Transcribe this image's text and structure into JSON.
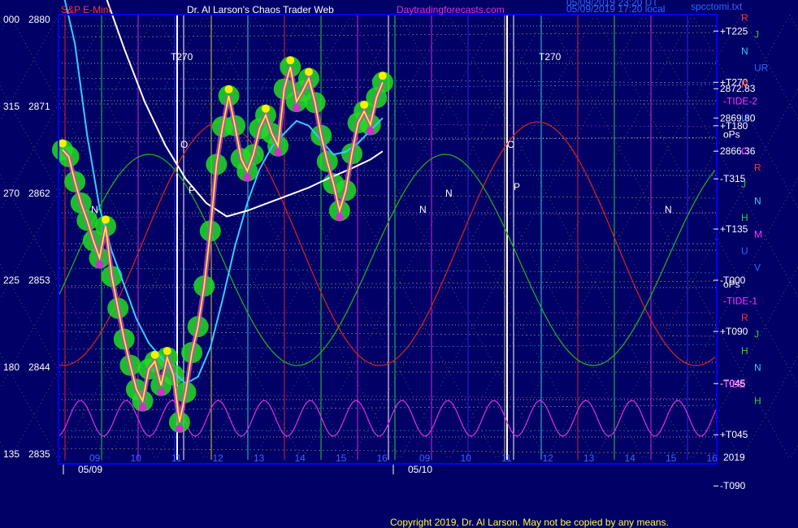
{
  "header": {
    "symbol": "S&P E-Mini",
    "title": "Dr. Al Larson's Chaos Trader Web",
    "site": "Daytradingforecasts.com",
    "stamp_line1": "05/09/2019 23:20 UT",
    "stamp_line2": "05/09/2019 17:20 local",
    "filename": "spcctomi.txt"
  },
  "footer": {
    "copyright": "Copyright 2019, Dr. Al Larson. May not be copied by any means.",
    "year_label": "2019"
  },
  "colors": {
    "background": "#000066",
    "border": "#0000ff",
    "price": "#ffff00",
    "mid_ma": "#33ccff",
    "slow_ma": "#ffffff",
    "glow": "#22dd22",
    "swing_high_marker": "#ffee00",
    "swing_low_marker": "#cc33cc",
    "red_path": "#cc2222",
    "green_path": "#22aa22",
    "tide_magenta": "#dd33dd"
  },
  "chart_data": {
    "type": "line",
    "title": "S&P E-Mini",
    "ylim": [
      2835,
      2880
    ],
    "left_axis": {
      "price_labels": [
        "2880",
        "2871",
        "2862",
        "2853",
        "2844",
        "2835"
      ],
      "degree_labels": [
        "000",
        "315",
        "270",
        "225",
        "180",
        "135"
      ]
    },
    "x_hour_labels": [
      "09",
      "10",
      "11",
      "12",
      "13",
      "14",
      "15",
      "16",
      "09",
      "10",
      "11",
      "12",
      "13",
      "14",
      "15",
      "16"
    ],
    "date_labels": [
      "05/09",
      "05/10"
    ],
    "right_axis_labels": [
      {
        "text": "+T225",
        "price": 2878.8
      },
      {
        "text": "+T270",
        "price": 2873.5
      },
      {
        "text": "2872.83",
        "price": 2872.83
      },
      {
        "text": "2869.80",
        "price": 2869.8
      },
      {
        "text": "+T180",
        "price": 2869.0
      },
      {
        "text": "2866.36",
        "price": 2866.36
      },
      {
        "text": "-T315",
        "price": 2863.5
      },
      {
        "text": "+T135",
        "price": 2858.3
      },
      {
        "text": "-T000",
        "price": 2853.0
      },
      {
        "text": "+T090",
        "price": 2847.7
      },
      {
        "text": "-T045",
        "price": 2842.3
      },
      {
        "text": "+T045",
        "price": 2837.0
      },
      {
        "text": "-T090",
        "price": 2831.7
      }
    ],
    "right_side_markers": [
      "R",
      "J",
      "N",
      "UR",
      "R",
      "-TIDE-2",
      "U",
      "oPs",
      "C",
      "R",
      "J",
      "N",
      "H",
      "M",
      "U",
      "V",
      "oPs",
      "-TIDE-1",
      "R",
      "J",
      "H",
      "N",
      "TIDE",
      "H"
    ],
    "chart_annotations": [
      "T270",
      "T270",
      "O",
      "O",
      "P",
      "P",
      "N",
      "N",
      "N",
      "N"
    ],
    "series": [
      {
        "name": "S&P E-Mini",
        "x": [
          0.0,
          0.15,
          0.3,
          0.45,
          0.6,
          0.75,
          0.9,
          1.05,
          1.2,
          1.35,
          1.5,
          1.65,
          1.8,
          1.95,
          2.1,
          2.25,
          2.4,
          2.55,
          2.7,
          2.85,
          3.0,
          3.15,
          3.3,
          3.45,
          3.6,
          3.75,
          3.9,
          4.05,
          4.2,
          4.35,
          4.5,
          4.65,
          4.8,
          4.95,
          5.1,
          5.25,
          5.4,
          5.55,
          5.7,
          5.85,
          6.0,
          6.15,
          6.3,
          6.45,
          6.6,
          6.75,
          6.9,
          7.05,
          7.2,
          7.35,
          7.5,
          7.65,
          7.8
        ],
        "values": [
          2866.5,
          2865.8,
          2863.2,
          2861.0,
          2859.2,
          2857.1,
          2855.3,
          2858.6,
          2853.4,
          2850.1,
          2846.9,
          2844.2,
          2841.7,
          2840.5,
          2843.8,
          2844.6,
          2842.1,
          2845.0,
          2843.2,
          2838.3,
          2841.4,
          2845.5,
          2848.2,
          2852.4,
          2858.1,
          2865.0,
          2868.9,
          2872.1,
          2869.0,
          2865.6,
          2864.3,
          2866.0,
          2868.7,
          2870.1,
          2868.2,
          2866.9,
          2872.8,
          2875.1,
          2871.5,
          2872.6,
          2873.9,
          2871.4,
          2868.0,
          2865.3,
          2863.0,
          2860.2,
          2862.3,
          2866.1,
          2869.3,
          2870.5,
          2869.1,
          2871.9,
          2873.5
        ]
      },
      {
        "name": "",
        "x": [
          0.0,
          0.3,
          0.6,
          0.9,
          1.2,
          1.5,
          1.8,
          2.1,
          2.4,
          2.7,
          3.0,
          3.3,
          3.6,
          3.9,
          4.2,
          4.5,
          4.8,
          5.1,
          5.4,
          5.7,
          6.0,
          6.3,
          6.6,
          6.9,
          7.2,
          7.5,
          7.8
        ],
        "values": [
          2883.0,
          2877.5,
          2868.0,
          2860.5,
          2856.0,
          2852.5,
          2849.0,
          2846.5,
          2845.0,
          2843.5,
          2842.3,
          2843.0,
          2846.0,
          2851.0,
          2856.5,
          2861.0,
          2864.5,
          2866.8,
          2868.2,
          2869.5,
          2869.0,
          2867.5,
          2866.0,
          2866.3,
          2867.2,
          2868.5,
          2869.8
        ]
      },
      {
        "name": "",
        "x": [
          1.0,
          1.5,
          2.0,
          2.5,
          3.0,
          3.5,
          4.0,
          4.5,
          5.0,
          5.5,
          6.0,
          6.5,
          7.0,
          7.5,
          7.8
        ],
        "values": [
          2883.0,
          2877.0,
          2871.5,
          2867.0,
          2863.5,
          2861.0,
          2859.6,
          2860.2,
          2861.0,
          2861.8,
          2862.6,
          2863.6,
          2864.5,
          2865.5,
          2866.36
        ]
      }
    ],
    "grid": true,
    "legend": "none"
  }
}
